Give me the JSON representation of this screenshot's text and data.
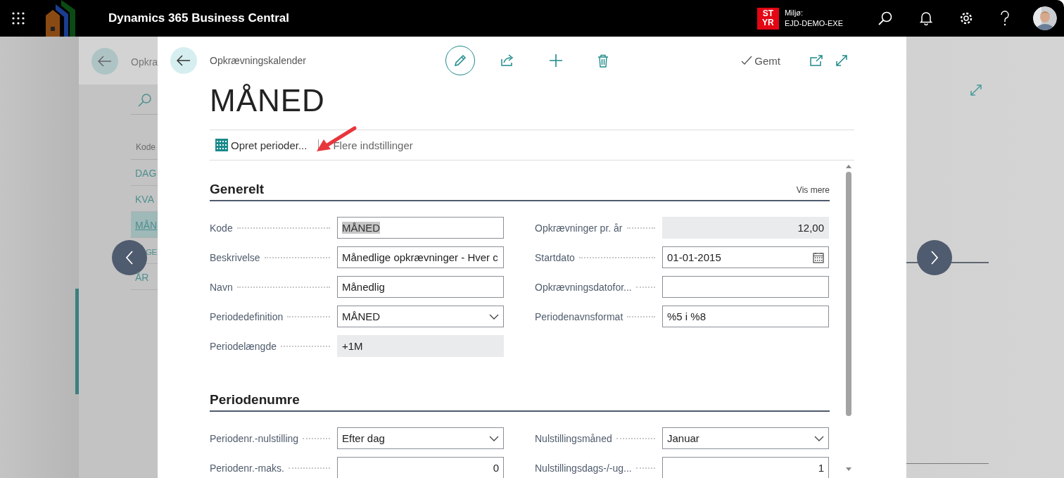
{
  "top_bar": {
    "app_title": "Dynamics 365 Business Central",
    "badge_lines": [
      "ST",
      "YR"
    ],
    "environment_label": "Miljø:",
    "environment_name": "EJD-DEMO-EXE"
  },
  "list_page": {
    "breadcrumb": "Opkra",
    "column": "Kode",
    "rows": [
      {
        "code": "DAG",
        "selected": false
      },
      {
        "code": "KVA",
        "selected": false
      },
      {
        "code": "MÅN",
        "selected": true
      },
      {
        "code": "GE",
        "selected": false
      },
      {
        "code": "ÅR",
        "selected": false
      }
    ]
  },
  "dialog": {
    "breadcrumb": "Opkrævningskalender",
    "save_status": "Gemt",
    "title": "MÅNED",
    "actions": [
      {
        "label": "Opret perioder...",
        "kind": "icon"
      },
      {
        "label": "Flere indstillinger",
        "kind": "plain"
      }
    ],
    "sections": [
      {
        "title": "Generelt",
        "show_more": "Vis mere",
        "left": [
          {
            "label": "Kode",
            "kind": "text",
            "value": "MÅNED",
            "highlighted": true
          },
          {
            "label": "Beskrivelse",
            "kind": "text",
            "value": "Månedlige opkrævninger - Hver c",
            "highlighted": false
          },
          {
            "label": "Navn",
            "kind": "text",
            "value": "Månedlig",
            "highlighted": false
          },
          {
            "label": "Periodedefinition",
            "kind": "dropdown",
            "value": "MÅNED",
            "highlighted": false
          },
          {
            "label": "Periodelængde",
            "kind": "readonly",
            "value": "+1M",
            "highlighted": false
          }
        ],
        "right": [
          {
            "label": "Opkrævninger pr. år",
            "kind": "readonly_number",
            "value": "12,00",
            "highlighted": false
          },
          {
            "label": "Startdato",
            "kind": "date",
            "value": "01-01-2015",
            "highlighted": false
          },
          {
            "label": "Opkrævningsdatofor...",
            "kind": "text"
          },
          {
            "label": "Periodenavnsformat",
            "kind": "text",
            "value": "%5 i %8",
            "highlighted": false
          }
        ]
      },
      {
        "title": "Periodenumre",
        "left": [
          {
            "label": "Periodenr.-nulstilling",
            "kind": "dropdown",
            "value": "Efter dag",
            "highlighted": false
          },
          {
            "label": "Periodenr.-maks.",
            "kind": "number",
            "value": "0",
            "highlighted": false
          }
        ],
        "right": [
          {
            "label": "Nulstillingsmåned",
            "kind": "dropdown",
            "value": "Januar",
            "highlighted": false
          },
          {
            "label": "Nulstillingsdags-/-ug...",
            "kind": "number",
            "value": "1",
            "highlighted": false
          }
        ]
      }
    ]
  }
}
